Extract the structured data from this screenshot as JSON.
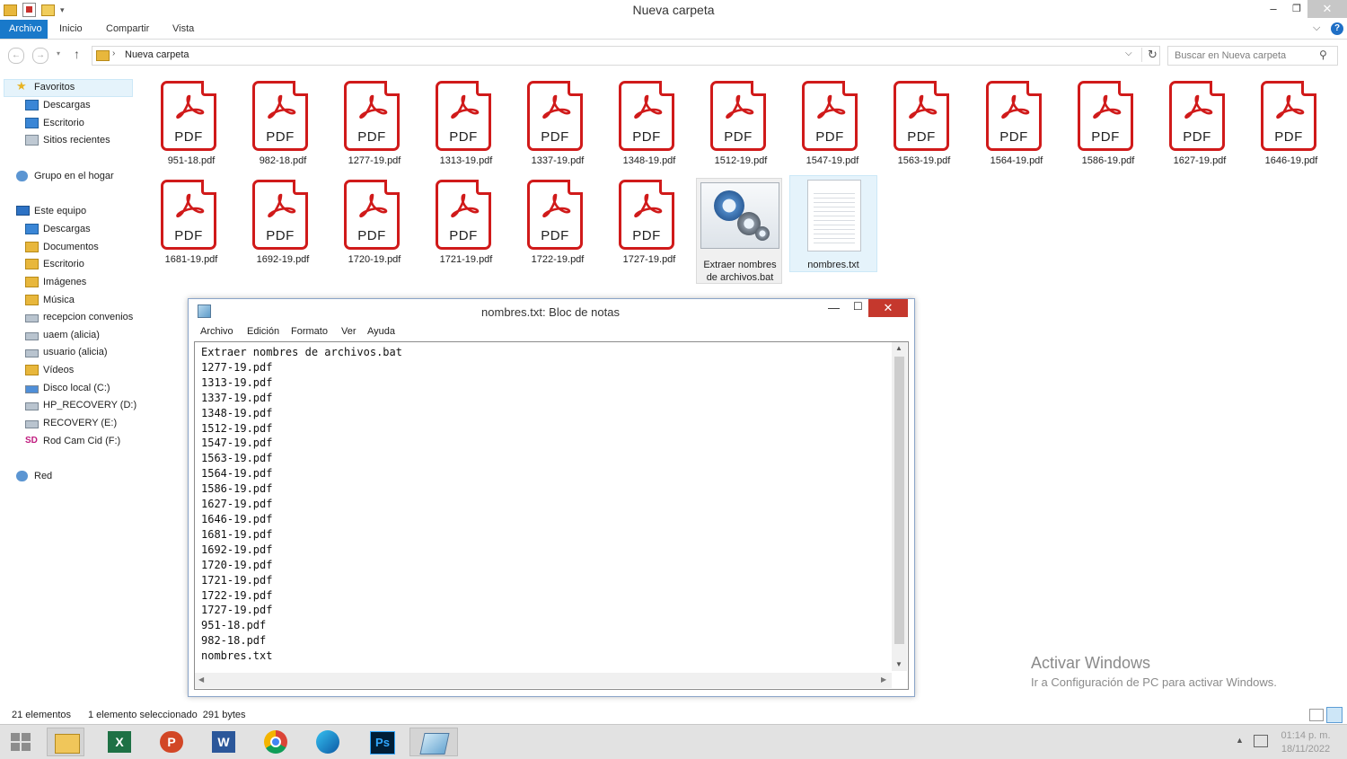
{
  "window": {
    "title": "Nueva carpeta",
    "min": "–",
    "max": "❐",
    "close": "✕"
  },
  "ribbon": {
    "tabs": [
      "Archivo",
      "Inicio",
      "Compartir",
      "Vista"
    ],
    "help": "?"
  },
  "address": {
    "path": "Nueva carpeta",
    "search_placeholder": "Buscar en Nueva carpeta"
  },
  "nav": {
    "favorites": "Favoritos",
    "fav_items": [
      "Descargas",
      "Escritorio",
      "Sitios recientes"
    ],
    "homegroup": "Grupo en el hogar",
    "computer": "Este equipo",
    "pc_items": [
      "Descargas",
      "Documentos",
      "Escritorio",
      "Imágenes",
      "Música",
      "recepcion convenios",
      "uaem (alicia)",
      "usuario (alicia)",
      "Vídeos",
      "Disco local (C:)",
      "HP_RECOVERY (D:)",
      "RECOVERY (E:)",
      "Rod Cam Cid (F:)"
    ],
    "network": "Red"
  },
  "files": {
    "pdf_label": "PDF",
    "row1": [
      "951-18.pdf",
      "982-18.pdf",
      "1277-19.pdf",
      "1313-19.pdf",
      "1337-19.pdf",
      "1348-19.pdf",
      "1512-19.pdf",
      "1547-19.pdf",
      "1563-19.pdf",
      "1564-19.pdf",
      "1586-19.pdf",
      "1627-19.pdf",
      "1646-19.pdf"
    ],
    "row2": [
      "1681-19.pdf",
      "1692-19.pdf",
      "1720-19.pdf",
      "1721-19.pdf",
      "1722-19.pdf",
      "1727-19.pdf"
    ],
    "bat": "Extraer nombres de archivos.bat",
    "txt": "nombres.txt"
  },
  "status": {
    "count": "21 elementos",
    "selection": "1 elemento seleccionado  291 bytes"
  },
  "activation": {
    "title": "Activar Windows",
    "subtitle": "Ir a Configuración de PC para activar Windows."
  },
  "clock": {
    "time": "01:14 p. m.",
    "date": "18/11/2022"
  },
  "notepad": {
    "title": "nombres.txt: Bloc de notas",
    "menu": [
      "Archivo",
      "Edición",
      "Formato",
      "Ver",
      "Ayuda"
    ],
    "content": "Extraer nombres de archivos.bat\n1277-19.pdf\n1313-19.pdf\n1337-19.pdf\n1348-19.pdf\n1512-19.pdf\n1547-19.pdf\n1563-19.pdf\n1564-19.pdf\n1586-19.pdf\n1627-19.pdf\n1646-19.pdf\n1681-19.pdf\n1692-19.pdf\n1720-19.pdf\n1721-19.pdf\n1722-19.pdf\n1727-19.pdf\n951-18.pdf\n982-18.pdf\nnombres.txt",
    "close": "✕",
    "min": "—",
    "max": "☐"
  },
  "taskbar": [
    "start-button",
    "file-explorer",
    "excel",
    "powerpoint",
    "word",
    "chrome",
    "edge",
    "photoshop",
    "notepad"
  ],
  "colors": {
    "accent": "#1979ca",
    "pdf_red": "#d01a1a",
    "close_red": "#c5382d"
  }
}
